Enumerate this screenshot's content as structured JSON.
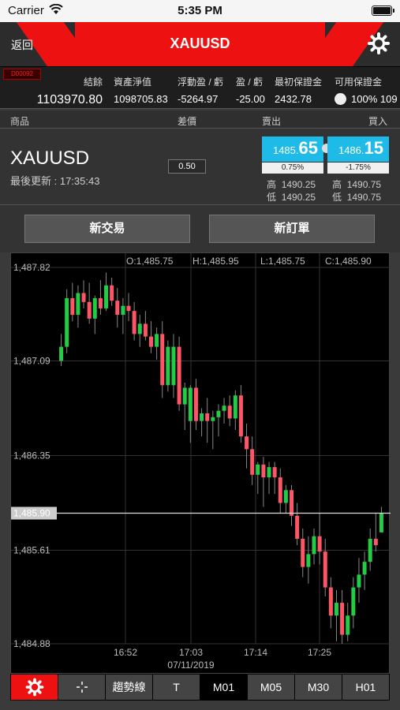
{
  "status": {
    "carrier": "Carrier",
    "time": "5:35 PM"
  },
  "nav": {
    "back": "返回",
    "title": "XAUUSD",
    "settings_icon": "gear-icon"
  },
  "account": {
    "tag": "D00092",
    "cols": [
      {
        "label": "結餘",
        "value": "1103970.80"
      },
      {
        "label": "資產淨值",
        "value": "1098705.83"
      },
      {
        "label": "浮動盈 / 虧",
        "value": "-5264.97"
      },
      {
        "label": "盈 / 虧",
        "value": "-25.00"
      },
      {
        "label": "最初保證金",
        "value": "2432.78"
      },
      {
        "label": "可用保證金",
        "value": "100%"
      }
    ],
    "overflow": "109"
  },
  "table_header": {
    "product": "商品",
    "spread": "差價",
    "sell": "賣出",
    "buy": "買入"
  },
  "quote": {
    "symbol": "XAUUSD",
    "updated": "最後更新 : 17:35:43",
    "spread": "0.50",
    "sell": {
      "small": "1485.",
      "big": "65",
      "pct": "0.75%",
      "high_label": "高",
      "high": "1490.25",
      "low_label": "低",
      "low": "1490.25"
    },
    "buy": {
      "small": "1486.",
      "big": "15",
      "pct": "-1.75%",
      "high_label": "高",
      "high": "1490.75",
      "low_label": "低",
      "low": "1490.75"
    }
  },
  "buttons": {
    "new_trade": "新交易",
    "new_order": "新訂單"
  },
  "chart_data": {
    "type": "candlestick",
    "ohlc_label": {
      "o": "O:1,485.75",
      "h": "H:1,485.95",
      "l": "L:1,485.75",
      "c": "C:1,485.90"
    },
    "y_ticks": [
      "1,487.82",
      "1,487.09",
      "1,486.35",
      "1,485.61",
      "1,484.88"
    ],
    "y_values": [
      1487.82,
      1487.09,
      1486.35,
      1485.61,
      1484.88
    ],
    "current_price": "1,485.90",
    "current_value": 1485.9,
    "x_ticks": [
      "16:52",
      "17:03",
      "17:14",
      "17:25"
    ],
    "x_date": "07/11/2019",
    "colors": {
      "up": "#22cc44",
      "down": "#ff5566",
      "grid": "#333333"
    },
    "candles": [
      [
        1487.09,
        1487.3,
        1487.05,
        1487.2
      ],
      [
        1487.2,
        1487.65,
        1487.15,
        1487.58
      ],
      [
        1487.58,
        1487.7,
        1487.4,
        1487.45
      ],
      [
        1487.45,
        1487.68,
        1487.35,
        1487.62
      ],
      [
        1487.62,
        1487.72,
        1487.5,
        1487.55
      ],
      [
        1487.55,
        1487.7,
        1487.38,
        1487.42
      ],
      [
        1487.42,
        1487.6,
        1487.3,
        1487.58
      ],
      [
        1487.58,
        1487.72,
        1487.45,
        1487.5
      ],
      [
        1487.5,
        1487.78,
        1487.48,
        1487.68
      ],
      [
        1487.68,
        1487.74,
        1487.52,
        1487.56
      ],
      [
        1487.56,
        1487.66,
        1487.35,
        1487.45
      ],
      [
        1487.45,
        1487.58,
        1487.3,
        1487.52
      ],
      [
        1487.52,
        1487.62,
        1487.4,
        1487.48
      ],
      [
        1487.48,
        1487.55,
        1487.25,
        1487.3
      ],
      [
        1487.3,
        1487.45,
        1487.2,
        1487.38
      ],
      [
        1487.38,
        1487.48,
        1487.25,
        1487.28
      ],
      [
        1487.28,
        1487.4,
        1487.15,
        1487.2
      ],
      [
        1487.2,
        1487.35,
        1487.1,
        1487.3
      ],
      [
        1487.3,
        1487.4,
        1486.8,
        1486.9
      ],
      [
        1486.9,
        1487.25,
        1486.85,
        1487.2
      ],
      [
        1486.9,
        1487.3,
        1486.8,
        1487.2
      ],
      [
        1487.2,
        1487.28,
        1486.7,
        1486.75
      ],
      [
        1486.75,
        1486.92,
        1486.55,
        1486.88
      ],
      [
        1486.62,
        1486.9,
        1486.45,
        1486.88
      ],
      [
        1486.88,
        1486.95,
        1486.55,
        1486.62
      ],
      [
        1486.62,
        1486.72,
        1486.5,
        1486.68
      ],
      [
        1486.68,
        1486.8,
        1486.45,
        1486.62
      ],
      [
        1486.62,
        1486.7,
        1486.4,
        1486.65
      ],
      [
        1486.65,
        1486.75,
        1486.5,
        1486.7
      ],
      [
        1486.7,
        1486.8,
        1486.6,
        1486.74
      ],
      [
        1486.74,
        1486.82,
        1486.58,
        1486.64
      ],
      [
        1486.64,
        1486.86,
        1486.55,
        1486.82
      ],
      [
        1486.82,
        1486.9,
        1486.45,
        1486.5
      ],
      [
        1486.5,
        1486.6,
        1486.25,
        1486.4
      ],
      [
        1486.4,
        1486.5,
        1486.12,
        1486.2
      ],
      [
        1486.2,
        1486.3,
        1486.05,
        1486.28
      ],
      [
        1486.28,
        1486.34,
        1485.95,
        1486.18
      ],
      [
        1486.18,
        1486.3,
        1486.05,
        1486.26
      ],
      [
        1486.26,
        1486.3,
        1486.05,
        1486.18
      ],
      [
        1486.18,
        1486.25,
        1485.9,
        1485.98
      ],
      [
        1485.98,
        1486.12,
        1485.9,
        1486.08
      ],
      [
        1486.08,
        1486.12,
        1485.8,
        1485.88
      ],
      [
        1485.88,
        1485.98,
        1485.65,
        1485.7
      ],
      [
        1485.7,
        1485.78,
        1485.4,
        1485.48
      ],
      [
        1485.48,
        1485.72,
        1485.35,
        1485.58
      ],
      [
        1485.58,
        1485.78,
        1485.5,
        1485.72
      ],
      [
        1485.72,
        1485.9,
        1485.5,
        1485.6
      ],
      [
        1485.6,
        1485.7,
        1485.25,
        1485.32
      ],
      [
        1485.32,
        1485.4,
        1485.0,
        1485.1
      ],
      [
        1485.1,
        1485.3,
        1484.9,
        1485.2
      ],
      [
        1485.2,
        1485.3,
        1484.88,
        1484.95
      ],
      [
        1484.95,
        1485.2,
        1484.9,
        1485.1
      ],
      [
        1485.1,
        1485.4,
        1485.0,
        1485.32
      ],
      [
        1485.32,
        1485.55,
        1485.2,
        1485.42
      ],
      [
        1485.42,
        1485.6,
        1485.3,
        1485.52
      ],
      [
        1485.52,
        1485.78,
        1485.45,
        1485.7
      ],
      [
        1485.7,
        1485.9,
        1485.6,
        1485.65
      ],
      [
        1485.75,
        1485.95,
        1485.75,
        1485.9
      ]
    ]
  },
  "toolbar": {
    "settings_icon": "gear-icon",
    "crosshair_icon": "crosshair-icon",
    "trend": "趨勢線",
    "t": "T",
    "m01": "M01",
    "m05": "M05",
    "m30": "M30",
    "h01": "H01"
  }
}
